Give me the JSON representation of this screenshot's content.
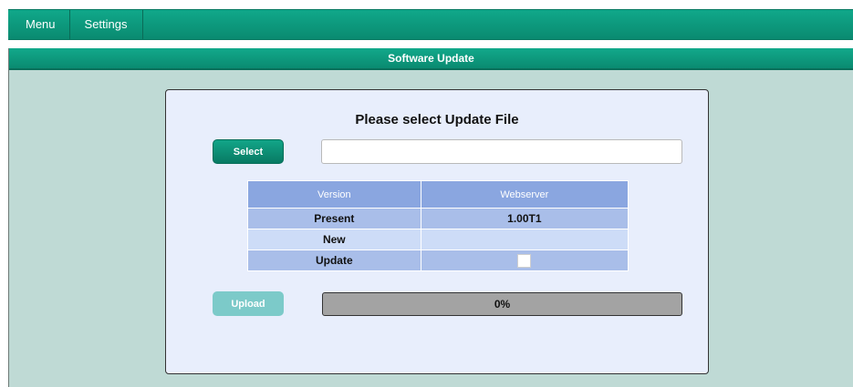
{
  "nav": {
    "items": [
      "Menu",
      "Settings"
    ]
  },
  "section": {
    "title": "Software Update"
  },
  "panel": {
    "title": "Please select Update File",
    "select_label": "Select",
    "file_value": "",
    "upload_label": "Upload"
  },
  "table": {
    "headers": [
      "Version",
      "Webserver"
    ],
    "rows": [
      {
        "label": "Present",
        "value": "1.00T1"
      },
      {
        "label": "New",
        "value": ""
      },
      {
        "label": "Update",
        "checked": false
      }
    ]
  },
  "progress": {
    "text": "0%",
    "value": 0
  },
  "colors": {
    "accent": "#0a8a70",
    "page_bg": "#bfdad5",
    "panel_bg": "#e8eefc",
    "header_blue": "#8aa6e0"
  }
}
